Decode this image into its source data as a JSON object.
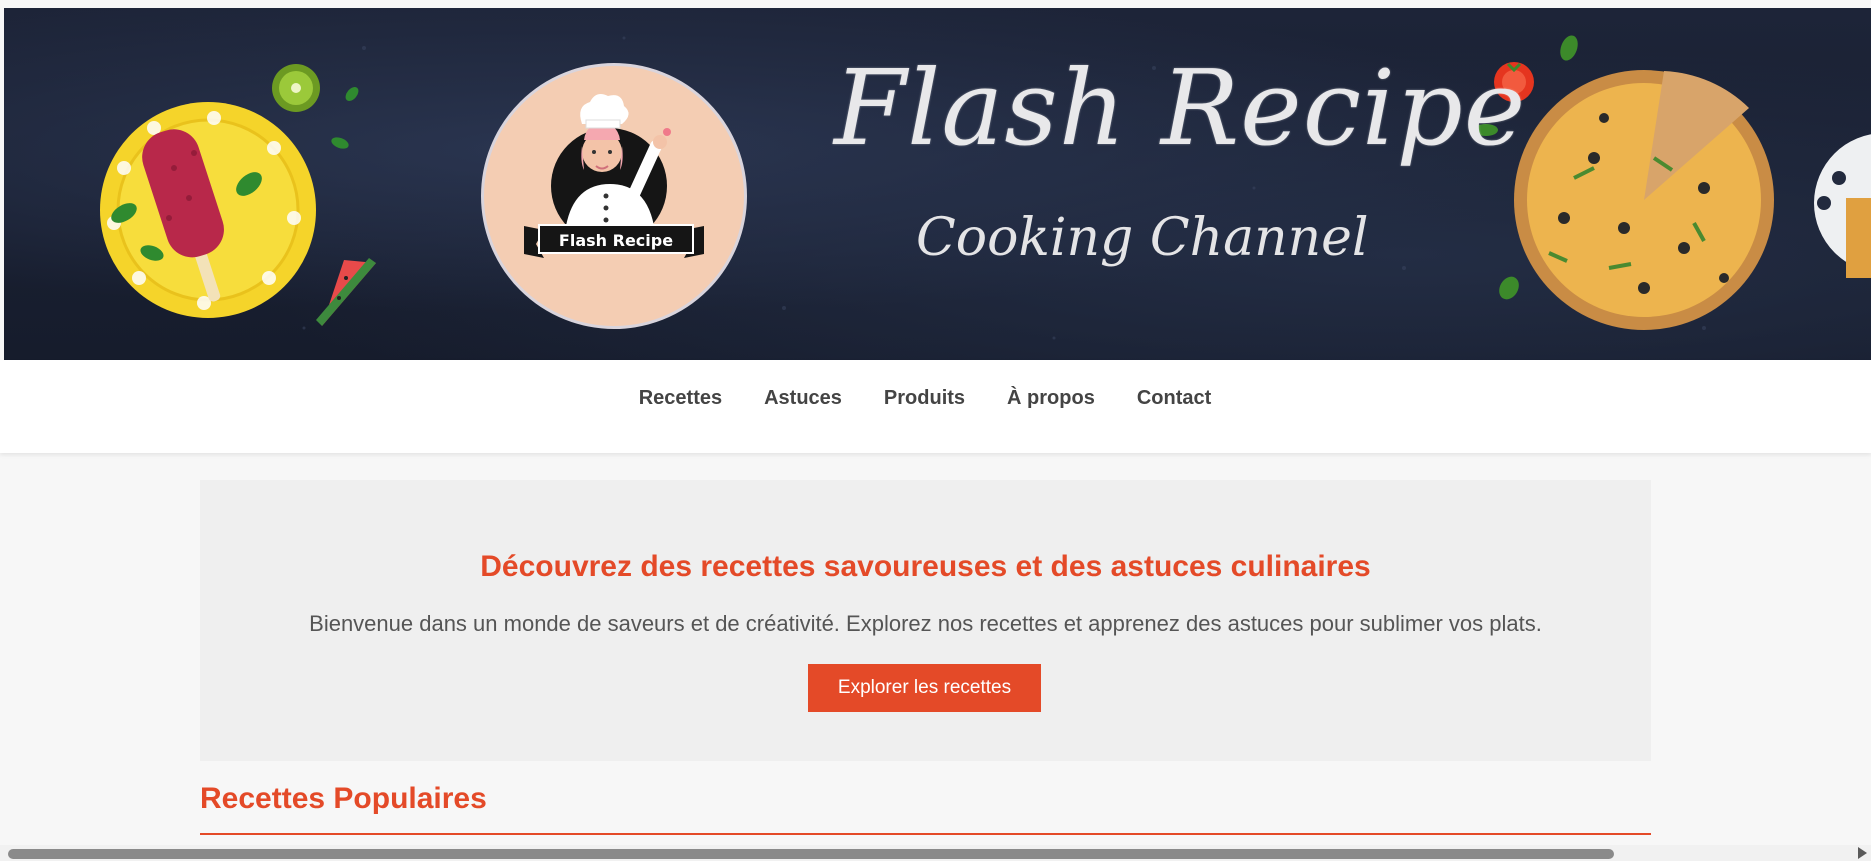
{
  "banner": {
    "title": "Flash Recipe",
    "subtitle": "Cooking Channel",
    "logo_label": "Flash Recipe"
  },
  "nav": {
    "items": [
      {
        "label": "Recettes"
      },
      {
        "label": "Astuces"
      },
      {
        "label": "Produits"
      },
      {
        "label": "À propos"
      },
      {
        "label": "Contact"
      }
    ]
  },
  "hero": {
    "title": "Découvrez des recettes savoureuses et des astuces culinaires",
    "text": "Bienvenue dans un monde de saveurs et de créativité. Explorez nos recettes et apprenez des astuces pour sublimer vos plats.",
    "button_label": "Explorer les recettes"
  },
  "popular": {
    "title": "Recettes Populaires"
  },
  "colors": {
    "accent": "#e44a28",
    "banner_bg": "#1d2438",
    "logo_bg": "#f4cdb3",
    "nav_text": "#444444",
    "hero_bg": "#efefef",
    "page_bg": "#f7f7f7"
  },
  "icons": {
    "popsicle_plate": "popsicle-plate-image",
    "kiwi": "kiwi-image",
    "watermelon": "watermelon-slice-image",
    "chef": "chef-mascot-image",
    "tomato": "tomato-image",
    "pizza": "pizza-image",
    "waffle_plate": "waffle-plate-image"
  }
}
